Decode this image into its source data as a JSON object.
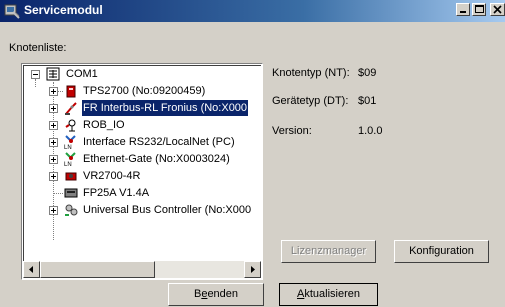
{
  "window": {
    "title": "Servicemodul"
  },
  "tree": {
    "label": "Knotenliste:",
    "root": "COM1",
    "items": [
      {
        "label": "TPS2700 (No:09200459)",
        "icon": "device-red-icon",
        "expandable": true,
        "selected": false
      },
      {
        "label": "FR Interbus-RL Fronius (No:X000",
        "icon": "robot-arm-icon",
        "expandable": true,
        "selected": true
      },
      {
        "label": "ROB_IO",
        "icon": "io-module-icon",
        "expandable": true,
        "selected": false
      },
      {
        "label": "Interface RS232/LocalNet (PC)",
        "icon": "localnet-icon",
        "expandable": true,
        "selected": false
      },
      {
        "label": "Ethernet-Gate (No:X0003024)",
        "icon": "ethernet-gate-icon",
        "expandable": true,
        "selected": false
      },
      {
        "label": "VR2700-4R",
        "icon": "wire-feeder-icon",
        "expandable": true,
        "selected": false
      },
      {
        "label": "FP25A V1.4A",
        "icon": "panel-icon",
        "expandable": false,
        "selected": false
      },
      {
        "label": "Universal Bus Controller (No:X000",
        "icon": "bus-controller-icon",
        "expandable": true,
        "selected": false
      }
    ]
  },
  "info": {
    "nodetype_label": "Knotentyp (NT):",
    "nodetype_value": "$09",
    "devicetype_label": "Gerätetyp (DT):",
    "devicetype_value": "$01",
    "version_label": "Version:",
    "version_value": "1.0.0"
  },
  "buttons": {
    "license": "Lizenzmanager",
    "configuration": "Konfiguration",
    "exit_prefix": "B",
    "exit_underline": "e",
    "exit_suffix": "enden",
    "refresh_underline": "A",
    "refresh_suffix": "ktualisieren"
  }
}
